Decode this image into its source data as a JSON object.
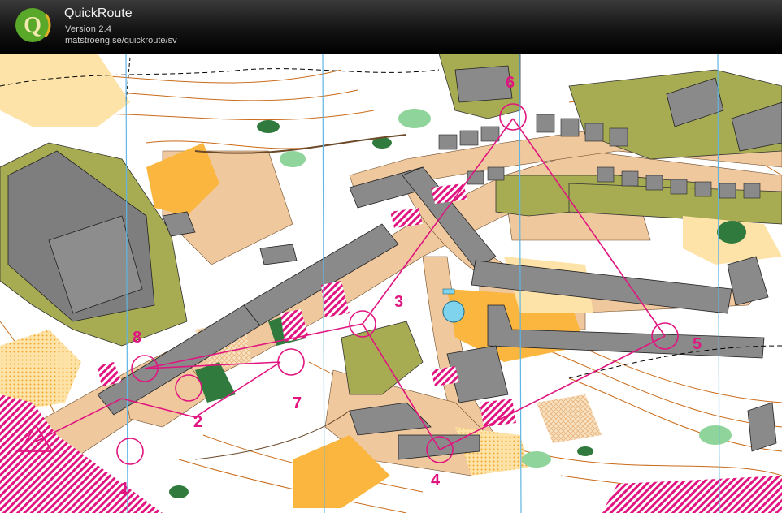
{
  "app": {
    "name": "QuickRoute",
    "version": "Version 2.4",
    "url": "matstroeng.se/quickroute/sv"
  },
  "logo": {
    "icon": "quickroute-q-logo-icon",
    "letter": "Q"
  },
  "colors": {
    "course": "#e0157f",
    "building": "#8a8a8a",
    "paved": "#f0c89e",
    "olive": "#a7ac52",
    "open_yellow": "#fbb640",
    "green": "#2f7a3c",
    "contour": "#c96a18",
    "water": "#7fd3ec",
    "magnetic_north": "#5fb5e3"
  },
  "course": {
    "start_symbol": "start-triangle-icon",
    "controls": [
      {
        "number": "1"
      },
      {
        "number": "2"
      },
      {
        "number": "3"
      },
      {
        "number": "4"
      },
      {
        "number": "5"
      },
      {
        "number": "6"
      },
      {
        "number": "7"
      },
      {
        "number": "8"
      }
    ]
  }
}
